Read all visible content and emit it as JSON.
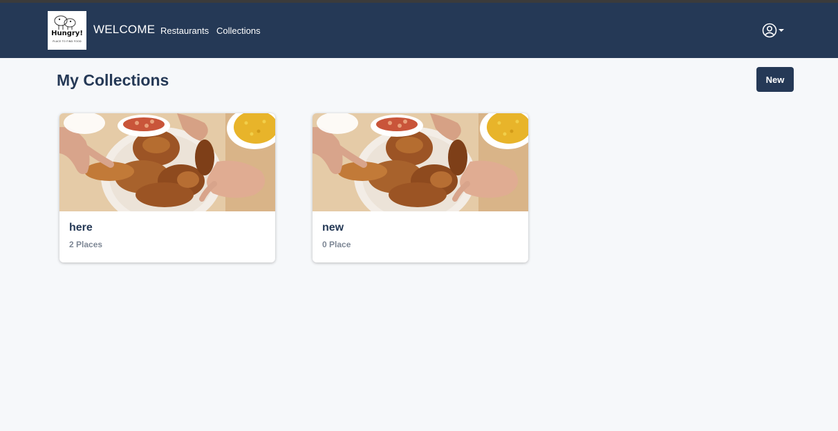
{
  "navbar": {
    "logo": {
      "text": "Hungry!",
      "tagline": "PLACE TO FIND FOOD"
    },
    "brand": "WELCOME",
    "links": [
      {
        "label": "Restaurants"
      },
      {
        "label": "Collections"
      }
    ],
    "user_icon": "user-circle-icon",
    "bg_color": "#253956"
  },
  "main": {
    "title": "My Collections",
    "new_button": "New",
    "collections": [
      {
        "name": "here",
        "count": "2 Places",
        "image": "roast-chicken-photo"
      },
      {
        "name": "new",
        "count": "0 Place",
        "image": "roast-chicken-photo"
      }
    ]
  },
  "colors": {
    "accent": "#253956",
    "background": "#f6f8fa",
    "muted_text": "#7d8795"
  }
}
